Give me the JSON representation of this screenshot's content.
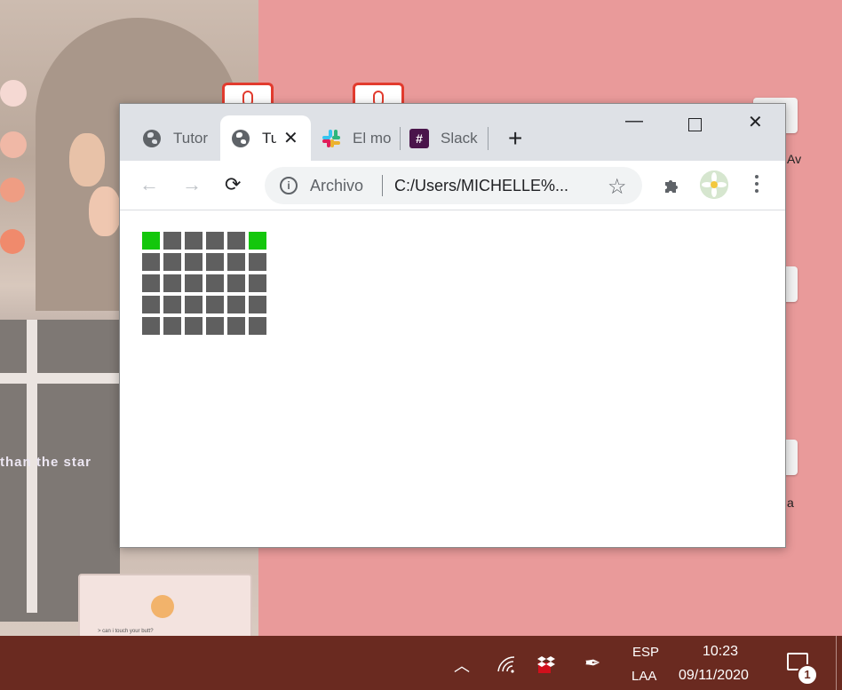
{
  "desktop": {
    "wallpaper_text": "than the star",
    "card_text": "> can i touch your butt?",
    "icon_labels": [
      "Av",
      "a"
    ]
  },
  "browser": {
    "tabs": [
      {
        "title": "Tutor",
        "icon": "globe-icon",
        "active": false
      },
      {
        "title": "Tu",
        "icon": "globe-icon",
        "active": true
      },
      {
        "title": "El mo",
        "icon": "slack-icon",
        "active": false
      },
      {
        "title": "Slack",
        "icon": "slack-icon",
        "active": false
      }
    ],
    "new_tab": "+",
    "window_controls": {
      "minimize": "—",
      "close": "✕"
    },
    "omnibox": {
      "label": "Archivo",
      "url": "C:/Users/MICHELLE%..."
    }
  },
  "content": {
    "grid": {
      "columns": 6,
      "rows": 5,
      "active_cells": [
        0,
        5
      ],
      "active_color": "#14c70c",
      "inactive_color": "#5f5f5f"
    }
  },
  "taskbar": {
    "lang_top": "ESP",
    "lang_bottom": "LAA",
    "time": "10:23",
    "date": "09/11/2020",
    "notification_count": "1"
  }
}
